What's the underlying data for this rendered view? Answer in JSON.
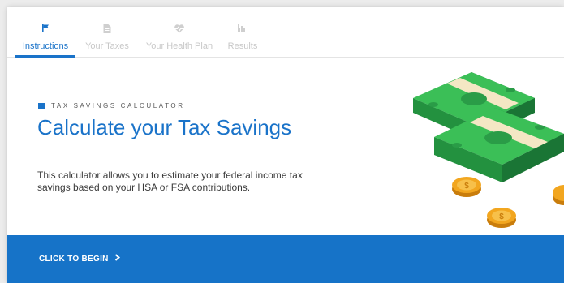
{
  "tabs": [
    {
      "label": "Instructions",
      "icon": "flag-icon"
    },
    {
      "label": "Your Taxes",
      "icon": "document-icon"
    },
    {
      "label": "Your Health Plan",
      "icon": "heart-rate-icon"
    },
    {
      "label": "Results",
      "icon": "bar-chart-icon"
    }
  ],
  "hero": {
    "eyebrow": "TAX SAVINGS CALCULATOR",
    "title": "Calculate your Tax Savings",
    "description": "This calculator allows you to estimate your federal income tax savings based on your HSA or FSA contributions."
  },
  "cta": {
    "label": "CLICK TO BEGIN"
  },
  "colors": {
    "accent": "#1a73c9",
    "cta_bar": "#1673c8",
    "cash_green": "#2fa84a",
    "coin_gold": "#f2a61f"
  }
}
